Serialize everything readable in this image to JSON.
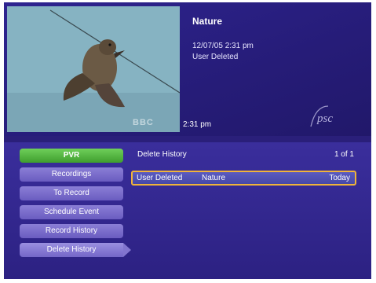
{
  "preview": {
    "channel_watermark": "BBC"
  },
  "program": {
    "title": "Nature",
    "datetime": "12/07/05  2:31 pm",
    "status": "User Deleted"
  },
  "clock": "2:31 pm",
  "logo": {
    "text": "psc"
  },
  "sidebar": {
    "header": "PVR",
    "items": [
      {
        "label": "Recordings"
      },
      {
        "label": "To Record"
      },
      {
        "label": "Schedule Event"
      },
      {
        "label": "Record History"
      },
      {
        "label": "Delete History"
      }
    ],
    "active_item": "Delete History"
  },
  "list": {
    "title": "Delete History",
    "page": "1 of 1",
    "rows": [
      {
        "status": "User Deleted",
        "title": "Nature",
        "date": "Today"
      }
    ]
  },
  "colors": {
    "background": "#2a1f7a",
    "header_green": "#3f9e2e",
    "menu_purple": "#6a5cc0",
    "selection_border": "#f0b43a"
  }
}
